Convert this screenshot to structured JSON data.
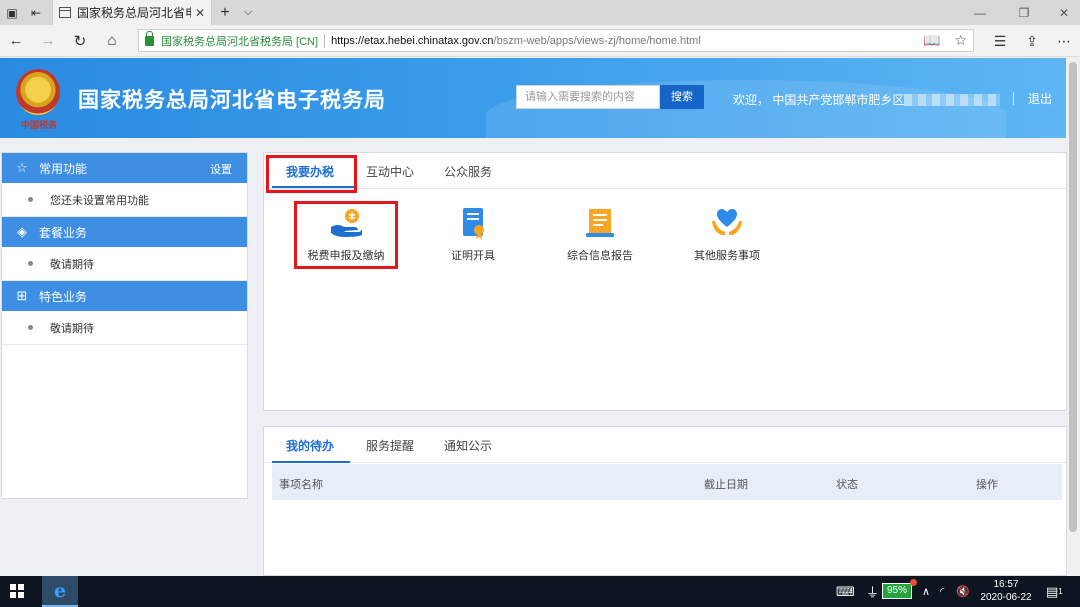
{
  "browser": {
    "tab_title": "国家税务总局河北省电子",
    "tab_close": "✕",
    "new_tab": "+",
    "tab_list": "⌵",
    "cert_label": "国家税务总局河北省税务局 [CN]",
    "url_host": "https://etax.hebei.chinatax.gov.cn",
    "url_path": "/bszm-web/apps/views-zj/home/home.html",
    "icons": [
      "back-icon",
      "forward-icon",
      "refresh-icon",
      "home-icon",
      "reading-view-icon",
      "favorite-star-icon",
      "favorites-hub-icon",
      "share-icon",
      "more-icon"
    ]
  },
  "header": {
    "emblem_caption": "中国税务",
    "site_title": "国家税务总局河北省电子税务局",
    "search_placeholder": "请输入需要搜索的内容",
    "search_button": "搜索",
    "welcome_text": "欢迎，  中国共产党邯郸市肥乡区",
    "logout": "退出"
  },
  "sidebar": {
    "sections": [
      {
        "title": "常用功能",
        "icon": "star-icon",
        "extra": "设置",
        "item": "您还未设置常用功能"
      },
      {
        "title": "套餐业务",
        "icon": "layers-icon",
        "item": "敬请期待"
      },
      {
        "title": "特色业务",
        "icon": "grid-icon",
        "item": "敬请期待"
      }
    ]
  },
  "main": {
    "tabs": [
      "我要办税",
      "互动中心",
      "公众服务"
    ],
    "services": [
      {
        "label": "税费申报及缴纳",
        "icon": "tax-payment-icon"
      },
      {
        "label": "证明开具",
        "icon": "certificate-icon"
      },
      {
        "label": "综合信息报告",
        "icon": "info-report-icon"
      },
      {
        "label": "其他服务事项",
        "icon": "heart-hand-icon"
      }
    ]
  },
  "pending": {
    "tabs": [
      "我的待办",
      "服务提醒",
      "通知公示"
    ],
    "columns": [
      "事项名称",
      "截止日期",
      "状态",
      "操作"
    ]
  },
  "taskbar": {
    "battery": "95%",
    "time": "16:57",
    "date": "2020-06-22",
    "notification_count": "1"
  },
  "colors": {
    "header_blue": "#2a8ae0",
    "sidebar_head": "#3e8ee4",
    "active_tab": "#1b6fd6",
    "highlight_red": "#e5161c"
  }
}
